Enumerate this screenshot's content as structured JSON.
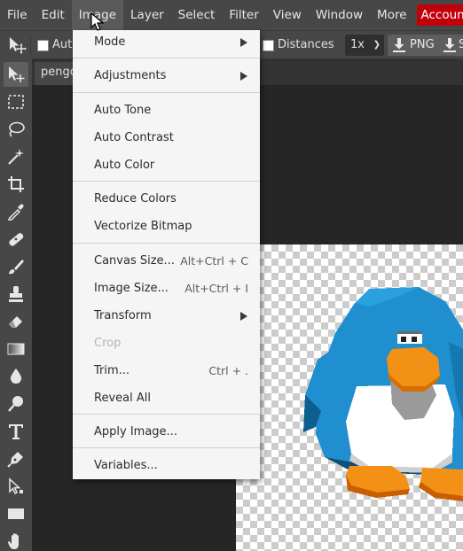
{
  "menubar": {
    "items": [
      "File",
      "Edit",
      "Image",
      "Layer",
      "Select",
      "Filter",
      "View",
      "Window",
      "More"
    ],
    "active": "Image",
    "account_label": "Account",
    "account_color": "#c2000b"
  },
  "options": {
    "auto_select_label": "Auto",
    "distances_label": "Distances",
    "zoom_value": "1x",
    "export_png_label": "PNG",
    "export_svg_label": "S"
  },
  "document": {
    "tab_label": "pengo"
  },
  "tools": [
    "move-tool-icon",
    "marquee-icon",
    "lasso-icon",
    "magic-wand-icon",
    "crop-icon",
    "eyedropper-icon",
    "healing-brush-icon",
    "brush-icon",
    "clone-stamp-icon",
    "eraser-icon",
    "gradient-icon",
    "blur-icon",
    "dodge-icon",
    "type-icon",
    "pen-icon",
    "path-select-icon",
    "shape-icon",
    "hand-icon"
  ],
  "image_menu": {
    "items": [
      {
        "label": "Mode",
        "shortcut": "",
        "submenu": true,
        "disabled": false
      },
      {
        "label": "Adjustments",
        "shortcut": "",
        "submenu": true,
        "disabled": false
      },
      {
        "label": "Auto Tone",
        "shortcut": "",
        "submenu": false,
        "disabled": false
      },
      {
        "label": "Auto Contrast",
        "shortcut": "",
        "submenu": false,
        "disabled": false
      },
      {
        "label": "Auto Color",
        "shortcut": "",
        "submenu": false,
        "disabled": false
      },
      {
        "label": "Reduce Colors",
        "shortcut": "",
        "submenu": false,
        "disabled": false
      },
      {
        "label": "Vectorize Bitmap",
        "shortcut": "",
        "submenu": false,
        "disabled": false
      },
      {
        "label": "Canvas Size...",
        "shortcut": "Alt+Ctrl + C",
        "submenu": false,
        "disabled": false
      },
      {
        "label": "Image Size...",
        "shortcut": "Alt+Ctrl + I",
        "submenu": false,
        "disabled": false
      },
      {
        "label": "Transform",
        "shortcut": "",
        "submenu": true,
        "disabled": false
      },
      {
        "label": "Crop",
        "shortcut": "",
        "submenu": false,
        "disabled": true
      },
      {
        "label": "Trim...",
        "shortcut": "Ctrl + .",
        "submenu": false,
        "disabled": false
      },
      {
        "label": "Reveal All",
        "shortcut": "",
        "submenu": false,
        "disabled": false
      },
      {
        "label": "Apply Image...",
        "shortcut": "",
        "submenu": false,
        "disabled": false
      },
      {
        "label": "Variables...",
        "shortcut": "",
        "submenu": false,
        "disabled": false
      }
    ]
  }
}
